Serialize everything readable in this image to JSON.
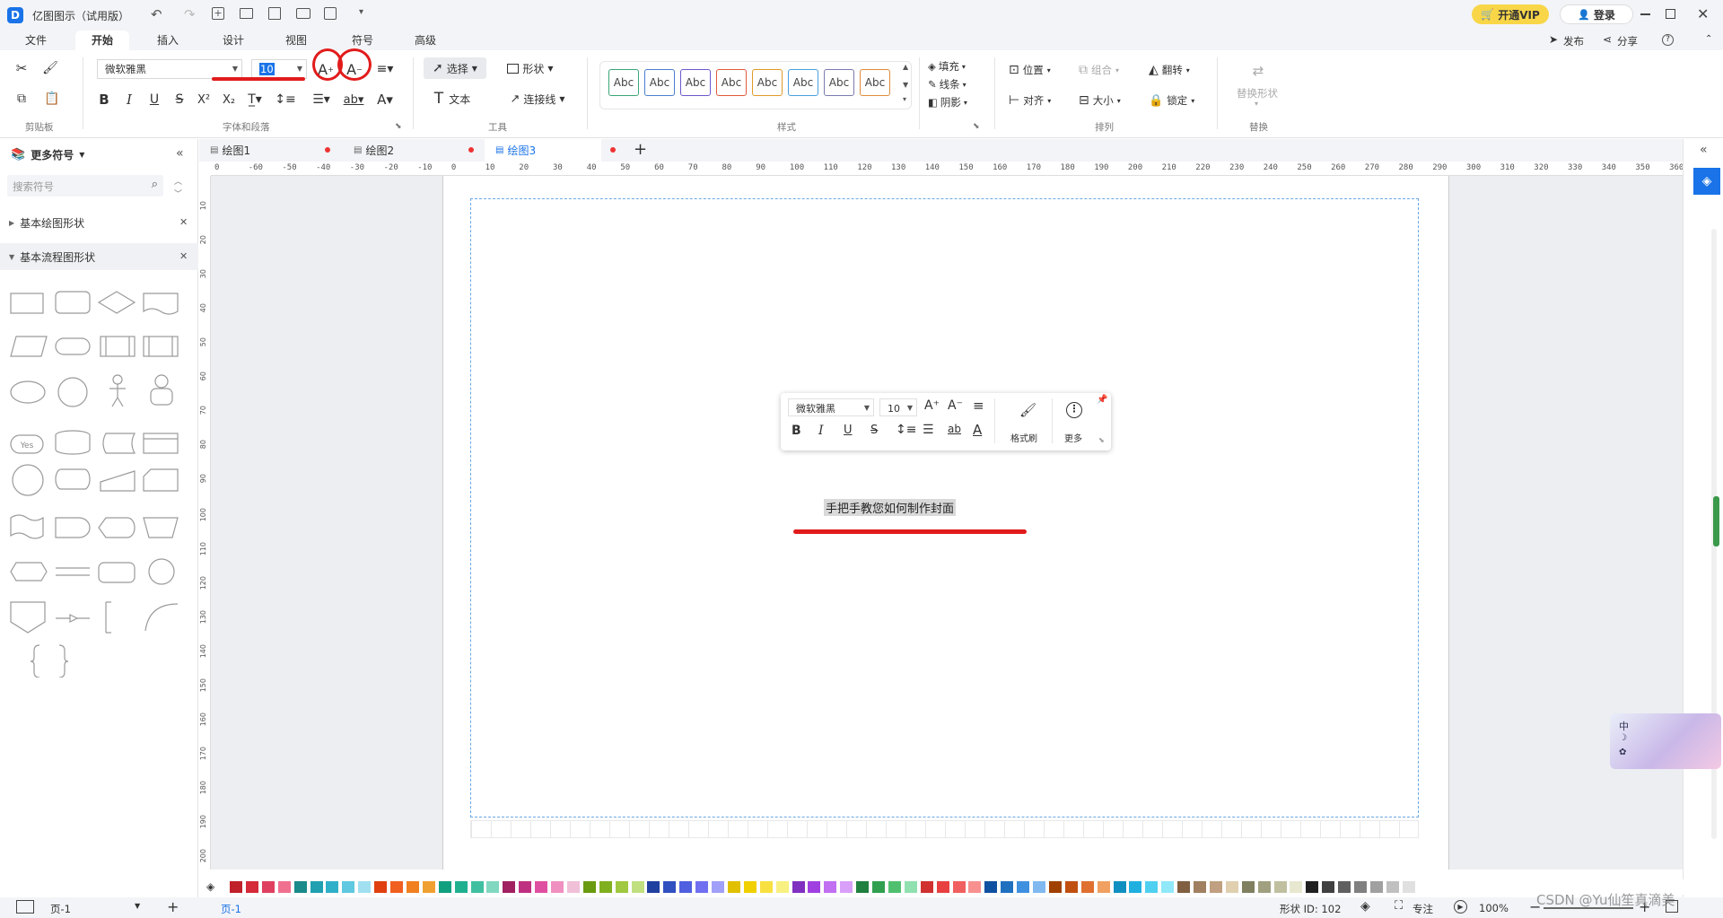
{
  "app": {
    "title": "亿图图示（试用版）",
    "vip_label": "开通VIP",
    "login_label": "登录"
  },
  "menu": {
    "tabs": [
      "文件",
      "开始",
      "插入",
      "设计",
      "视图",
      "符号",
      "高级"
    ],
    "publish": "发布",
    "share": "分享"
  },
  "ribbon": {
    "font_family": "微软雅黑",
    "font_size": "10",
    "groups": {
      "clipboard": "剪贴板",
      "font": "字体和段落",
      "tools": "工具",
      "styles": "样式",
      "arrange": "排列",
      "replace": "替换"
    },
    "tools": {
      "select": "选择",
      "shape": "形状",
      "text": "文本",
      "connector": "连接线"
    },
    "style_samples": [
      "Abc",
      "Abc",
      "Abc",
      "Abc",
      "Abc",
      "Abc",
      "Abc",
      "Abc"
    ],
    "style_colors": [
      "#3aa676",
      "#4a7fd0",
      "#6a5acd",
      "#e05a3a",
      "#e09a2a",
      "#4aa0e0",
      "#7a7ab0",
      "#e08a3a"
    ],
    "fill": "填充",
    "line": "线条",
    "shadow": "阴影",
    "position": "位置",
    "group": "组合",
    "flip": "翻转",
    "align": "对齐",
    "size": "大小",
    "lock": "锁定",
    "replace_shape": "替换形状"
  },
  "left_panel": {
    "title": "更多符号",
    "search_placeholder": "搜索符号",
    "categories": [
      "基本绘图形状",
      "基本流程图形状"
    ],
    "shape_text_yes": "Yes"
  },
  "doc_tabs": [
    "绘图1",
    "绘图2",
    "绘图3"
  ],
  "ruler_h": [
    "0",
    "-60",
    "-50",
    "-40",
    "-30",
    "-20",
    "-10",
    "0",
    "10",
    "20",
    "30",
    "40",
    "50",
    "60",
    "70",
    "80",
    "90",
    "100",
    "110",
    "120",
    "130",
    "140",
    "150",
    "160",
    "170",
    "180",
    "190",
    "200",
    "210",
    "220",
    "230",
    "240",
    "250",
    "260",
    "270",
    "280",
    "290",
    "300",
    "310",
    "320",
    "330",
    "340",
    "350",
    "360"
  ],
  "ruler_v": [
    "10",
    "20",
    "30",
    "40",
    "50",
    "60",
    "70",
    "80",
    "90",
    "100",
    "110",
    "120",
    "130",
    "140",
    "150",
    "160",
    "170",
    "180",
    "190",
    "200"
  ],
  "canvas": {
    "text": "手把手教您如何制作封面"
  },
  "floatbar": {
    "font": "微软雅黑",
    "size": "10",
    "format_painter": "格式刷",
    "more": "更多"
  },
  "palette": [
    "#c0202a",
    "#d42a3a",
    "#e04060",
    "#f07090",
    "#1a8a8a",
    "#20a0b0",
    "#30b0c8",
    "#60c8e0",
    "#a0e0f0",
    "#e04010",
    "#f06020",
    "#f08020",
    "#f0a030",
    "#10a080",
    "#20b090",
    "#40c0a0",
    "#80d8c0",
    "#a02060",
    "#c03080",
    "#e050a0",
    "#f090c0",
    "#f0c0d8",
    "#6a9a10",
    "#80b020",
    "#a0c840",
    "#c0e080",
    "#2040a0",
    "#3050c0",
    "#5060e0",
    "#7070f0",
    "#a0a0f8",
    "#e0c000",
    "#f0d000",
    "#f8e040",
    "#f8f080",
    "#8030c0",
    "#a040e0",
    "#c070f0",
    "#d8a0f8",
    "#208040",
    "#30a050",
    "#50c070",
    "#90e0b0",
    "#d03030",
    "#e84040",
    "#f06060",
    "#f89090",
    "#1050a0",
    "#2070c0",
    "#4090e0",
    "#80b8f0",
    "#a04000",
    "#c05010",
    "#e07030",
    "#f0a060",
    "#1090c0",
    "#20b0e0",
    "#50d0f0",
    "#90e8f8",
    "#806040",
    "#a08060",
    "#c0a080",
    "#e0d0b0",
    "#808060",
    "#a0a080",
    "#c0c0a0",
    "#e8e8d0",
    "#202020",
    "#404040",
    "#606060",
    "#808080",
    "#a0a0a0",
    "#c0c0c0",
    "#e0e0e0"
  ],
  "status": {
    "page": "页-1",
    "page_tab": "页-1",
    "shape_id": "形状 ID: 102",
    "focus": "专注",
    "zoom": "100%",
    "watermark": "CSDN @Yu仙笙真滴美",
    "ime": "中"
  }
}
